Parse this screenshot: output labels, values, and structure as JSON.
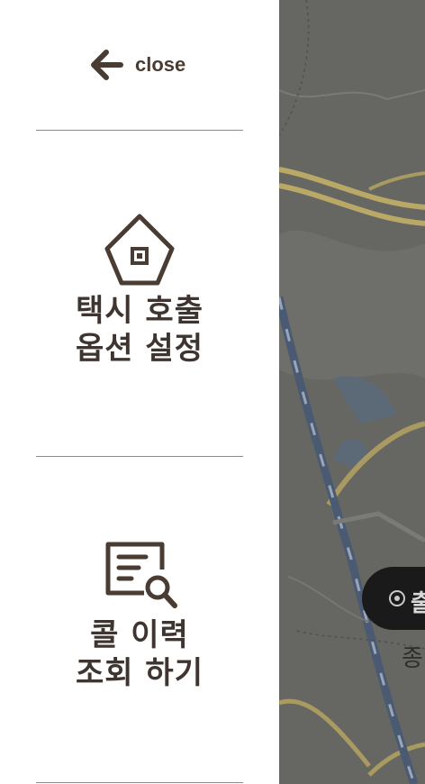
{
  "drawer": {
    "close_label": "close",
    "menu": [
      {
        "line1": "택시 호출",
        "line2": "옵션 설정",
        "icon": "house-icon"
      },
      {
        "line1": "콜 이력",
        "line2": "조회 하기",
        "icon": "document-search-icon"
      }
    ]
  },
  "map": {
    "pill_text": "출",
    "label": "종"
  },
  "colors": {
    "drawer_background": "#ffffff",
    "text": "#3e3530",
    "overlay": "#5f5f5c"
  }
}
